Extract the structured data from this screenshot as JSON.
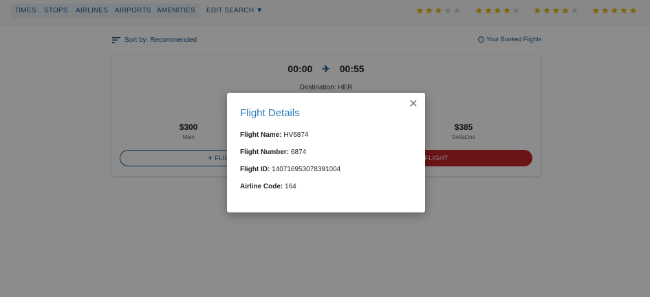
{
  "filters": {
    "times": "TIMES",
    "stops": "STOPS",
    "airlines": "AIRLINES",
    "airports": "AIRPORTS",
    "amenities": "AMENITIES",
    "edit_search": "EDIT SEARCH ▼"
  },
  "ratings": [
    3,
    4,
    4,
    5
  ],
  "sort": {
    "label": "Sort by: Recommended"
  },
  "booked_link": "Your Booked Flights",
  "flight_card": {
    "depart": "00:00",
    "arrive": "00:55",
    "destination": "Destination: HER",
    "fares": [
      {
        "price": "$300",
        "class": "Main"
      },
      {
        "price": "$385",
        "class": "DeltaOne"
      }
    ],
    "flight_button": "FLIGHT",
    "cancel_button": "CEL FLIGHT"
  },
  "modal": {
    "title": "Flight Details",
    "flight_name_label": "Flight Name:",
    "flight_name": "HV6874",
    "flight_number_label": "Flight Number:",
    "flight_number": "6874",
    "flight_id_label": "Flight ID:",
    "flight_id": "140716953078391004",
    "airline_code_label": "Airline Code:",
    "airline_code": "164"
  },
  "colors": {
    "accent": "#1e5a8c",
    "modal_title": "#2a7cb8",
    "cancel": "#c1252d",
    "star": "#e6b800"
  }
}
